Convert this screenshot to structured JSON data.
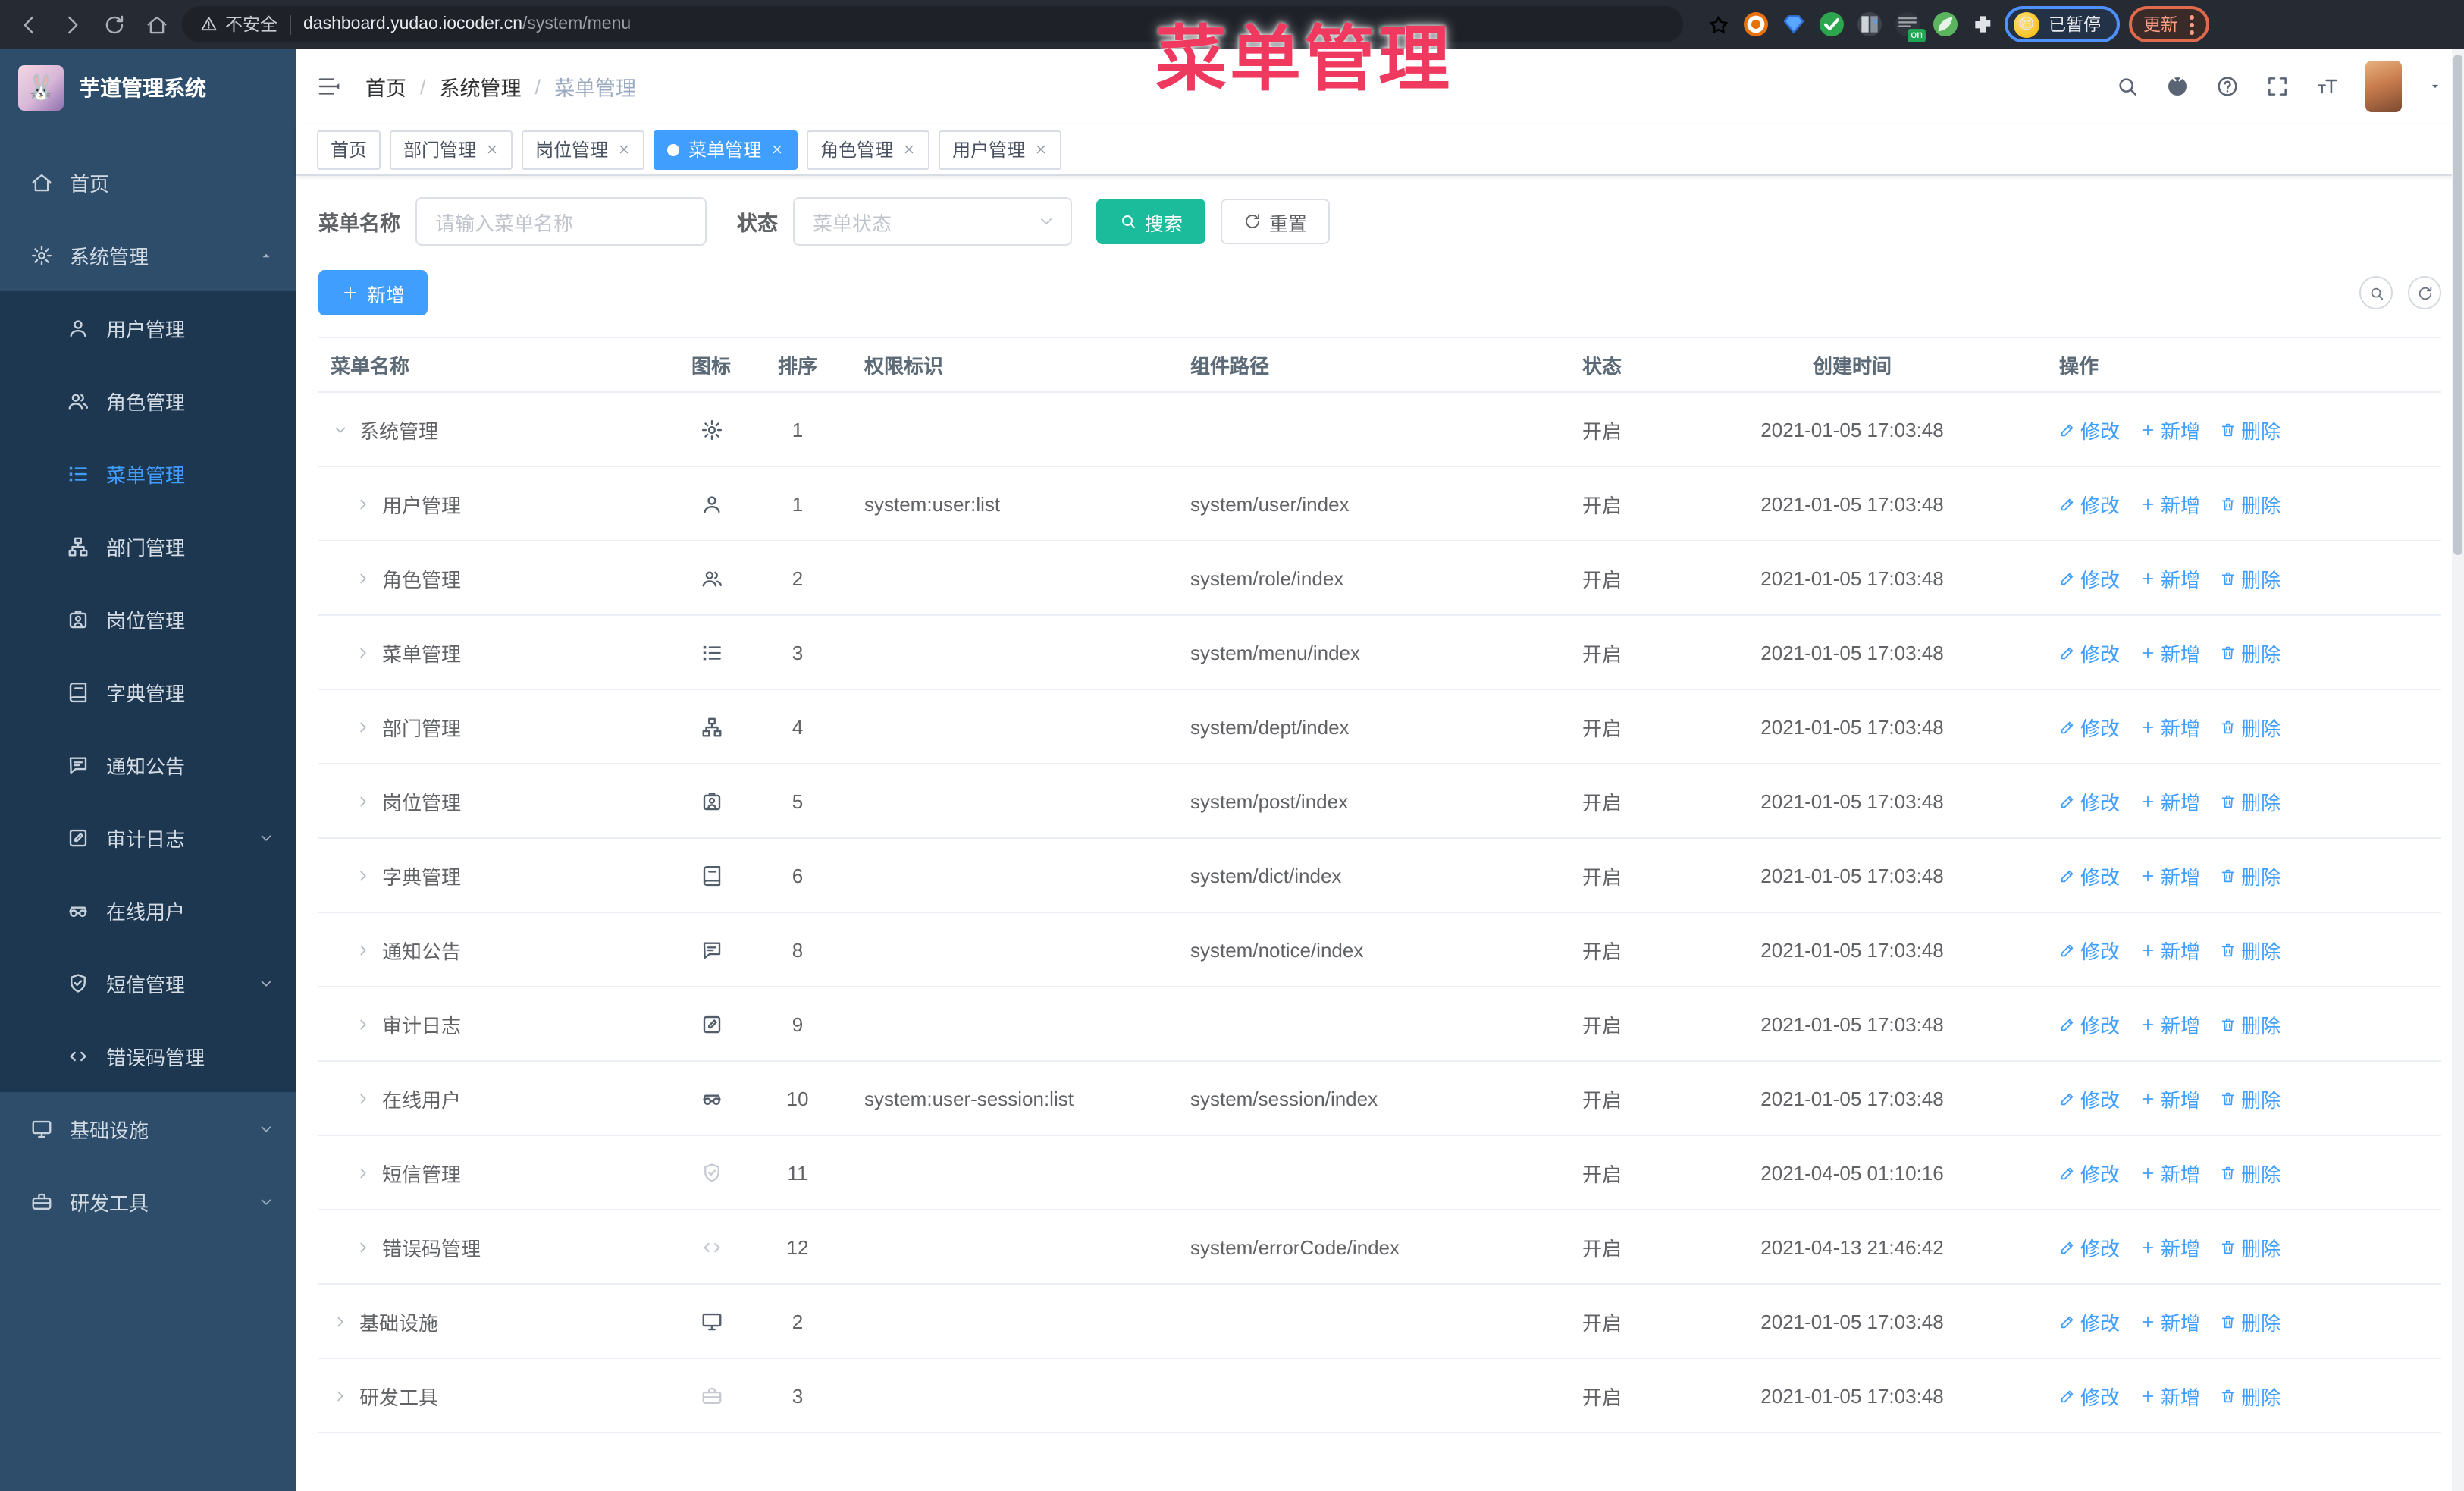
{
  "browser": {
    "security_label": "不安全",
    "url_host": "dashboard.yudao.iocoder.cn",
    "url_path": "/system/menu",
    "paused_badge": "已暂停",
    "update_button": "更新",
    "nav_icons": [
      "back-icon",
      "forward-icon",
      "reload-icon",
      "home-icon"
    ],
    "extension_icons": [
      {
        "name": "bookmark-star-icon",
        "bg": "transparent",
        "glyph": "star"
      },
      {
        "name": "ext-orange-icon",
        "bg": "#e8710a",
        "glyph": "ring"
      },
      {
        "name": "ext-gem-icon",
        "bg": "transparent",
        "glyph": "gem"
      },
      {
        "name": "ext-green-check-icon",
        "bg": "#2da44e",
        "glyph": "check"
      },
      {
        "name": "ext-columns-icon",
        "bg": "#3d434d",
        "glyph": "columns"
      },
      {
        "name": "ext-dark-on-icon",
        "bg": "#30353d",
        "glyph": "on-badge",
        "badge": "on",
        "badge_color": "#21a453"
      },
      {
        "name": "ext-green-icon",
        "bg": "#5bb55f",
        "glyph": "leaf"
      },
      {
        "name": "ext-puzzle-icon",
        "bg": "transparent",
        "glyph": "puzzle"
      }
    ]
  },
  "overlay": {
    "title": "菜单管理",
    "color": "#f0395f"
  },
  "sidebar": {
    "title": "芋道管理系统",
    "items": [
      {
        "label": "首页",
        "icon": "home"
      },
      {
        "label": "系统管理",
        "icon": "gear",
        "caret": "up",
        "expanded": true,
        "children": [
          {
            "label": "用户管理",
            "icon": "user"
          },
          {
            "label": "角色管理",
            "icon": "users"
          },
          {
            "label": "菜单管理",
            "icon": "menu",
            "active": true
          },
          {
            "label": "部门管理",
            "icon": "tree"
          },
          {
            "label": "岗位管理",
            "icon": "badge"
          },
          {
            "label": "字典管理",
            "icon": "dict"
          },
          {
            "label": "通知公告",
            "icon": "message"
          },
          {
            "label": "审计日志",
            "icon": "log",
            "caret": "down"
          },
          {
            "label": "在线用户",
            "icon": "online"
          },
          {
            "label": "短信管理",
            "icon": "sms",
            "caret": "down"
          },
          {
            "label": "错误码管理",
            "icon": "code"
          }
        ]
      },
      {
        "label": "基础设施",
        "icon": "monitor",
        "caret": "down"
      },
      {
        "label": "研发工具",
        "icon": "toolbox",
        "caret": "down"
      }
    ]
  },
  "header": {
    "breadcrumb": [
      "首页",
      "系统管理",
      "菜单管理"
    ],
    "right_icons": [
      "search",
      "github",
      "question",
      "fullscreen",
      "fontsize"
    ]
  },
  "tabs": [
    {
      "label": "首页",
      "closable": false,
      "active": false
    },
    {
      "label": "部门管理",
      "closable": true,
      "active": false
    },
    {
      "label": "岗位管理",
      "closable": true,
      "active": false
    },
    {
      "label": "菜单管理",
      "closable": true,
      "active": true
    },
    {
      "label": "角色管理",
      "closable": true,
      "active": false
    },
    {
      "label": "用户管理",
      "closable": true,
      "active": false
    }
  ],
  "filter": {
    "name_label": "菜单名称",
    "name_placeholder": "请输入菜单名称",
    "status_label": "状态",
    "status_placeholder": "菜单状态",
    "search_button": "搜索",
    "reset_button": "重置"
  },
  "toolbar": {
    "add_button": "新增"
  },
  "table": {
    "headers": [
      "菜单名称",
      "图标",
      "排序",
      "权限标识",
      "组件路径",
      "状态",
      "创建时间",
      "操作"
    ],
    "row_ops": [
      {
        "label": "修改",
        "icon": "edit"
      },
      {
        "label": "新增",
        "icon": "plus"
      },
      {
        "label": "删除",
        "icon": "trash"
      }
    ],
    "rows": [
      {
        "name": "系统管理",
        "level": 0,
        "expanded": true,
        "icon": "gear",
        "icon_light": false,
        "sort": "1",
        "perm": "",
        "path": "",
        "status": "开启",
        "time": "2021-01-05 17:03:48"
      },
      {
        "name": "用户管理",
        "level": 1,
        "expanded": false,
        "icon": "user",
        "icon_light": false,
        "sort": "1",
        "perm": "system:user:list",
        "path": "system/user/index",
        "status": "开启",
        "time": "2021-01-05 17:03:48"
      },
      {
        "name": "角色管理",
        "level": 1,
        "expanded": false,
        "icon": "users",
        "icon_light": false,
        "sort": "2",
        "perm": "",
        "path": "system/role/index",
        "status": "开启",
        "time": "2021-01-05 17:03:48"
      },
      {
        "name": "菜单管理",
        "level": 1,
        "expanded": false,
        "icon": "menu",
        "icon_light": false,
        "sort": "3",
        "perm": "",
        "path": "system/menu/index",
        "status": "开启",
        "time": "2021-01-05 17:03:48"
      },
      {
        "name": "部门管理",
        "level": 1,
        "expanded": false,
        "icon": "tree",
        "icon_light": false,
        "sort": "4",
        "perm": "",
        "path": "system/dept/index",
        "status": "开启",
        "time": "2021-01-05 17:03:48"
      },
      {
        "name": "岗位管理",
        "level": 1,
        "expanded": false,
        "icon": "badge",
        "icon_light": false,
        "sort": "5",
        "perm": "",
        "path": "system/post/index",
        "status": "开启",
        "time": "2021-01-05 17:03:48"
      },
      {
        "name": "字典管理",
        "level": 1,
        "expanded": false,
        "icon": "dict",
        "icon_light": false,
        "sort": "6",
        "perm": "",
        "path": "system/dict/index",
        "status": "开启",
        "time": "2021-01-05 17:03:48"
      },
      {
        "name": "通知公告",
        "level": 1,
        "expanded": false,
        "icon": "message",
        "icon_light": false,
        "sort": "8",
        "perm": "",
        "path": "system/notice/index",
        "status": "开启",
        "time": "2021-01-05 17:03:48"
      },
      {
        "name": "审计日志",
        "level": 1,
        "expanded": false,
        "icon": "log",
        "icon_light": false,
        "sort": "9",
        "perm": "",
        "path": "",
        "status": "开启",
        "time": "2021-01-05 17:03:48"
      },
      {
        "name": "在线用户",
        "level": 1,
        "expanded": false,
        "icon": "online",
        "icon_light": false,
        "sort": "10",
        "perm": "system:user-session:list",
        "path": "system/session/index",
        "status": "开启",
        "time": "2021-01-05 17:03:48"
      },
      {
        "name": "短信管理",
        "level": 1,
        "expanded": false,
        "icon": "sms",
        "icon_light": true,
        "sort": "11",
        "perm": "",
        "path": "",
        "status": "开启",
        "time": "2021-04-05 01:10:16"
      },
      {
        "name": "错误码管理",
        "level": 1,
        "expanded": false,
        "icon": "code",
        "icon_light": true,
        "sort": "12",
        "perm": "",
        "path": "system/errorCode/index",
        "status": "开启",
        "time": "2021-04-13 21:46:42"
      },
      {
        "name": "基础设施",
        "level": 0,
        "expanded": false,
        "icon": "monitor",
        "icon_light": false,
        "sort": "2",
        "perm": "",
        "path": "",
        "status": "开启",
        "time": "2021-01-05 17:03:48"
      },
      {
        "name": "研发工具",
        "level": 0,
        "expanded": false,
        "icon": "toolbox",
        "icon_light": true,
        "sort": "3",
        "perm": "",
        "path": "",
        "status": "开启",
        "time": "2021-01-05 17:03:48"
      }
    ]
  },
  "colors": {
    "primary": "#409eff",
    "search_button": "#1abc9c",
    "active_tag": "#409eff",
    "sidebar_bg": "#2e4d6a",
    "submenu_bg": "#1e3750",
    "chrome_bg": "#262b33",
    "overlay_pink": "#f0395f"
  }
}
